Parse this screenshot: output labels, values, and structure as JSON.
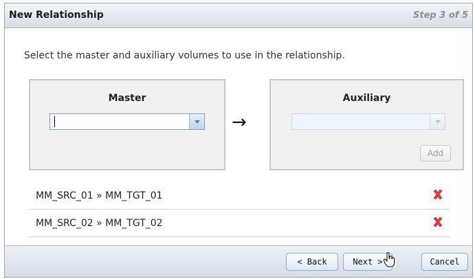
{
  "dialog": {
    "title": "New Relationship",
    "step": "Step 3 of 5"
  },
  "instruction": "Select the master and auxiliary volumes to use in the relationship.",
  "master": {
    "label": "Master",
    "value": ""
  },
  "auxiliary": {
    "label": "Auxiliary",
    "value": "",
    "add_label": "Add"
  },
  "arrow": "→",
  "relationships": [
    {
      "label": "MM_SRC_01 » MM_TGT_01"
    },
    {
      "label": "MM_SRC_02 » MM_TGT_02"
    }
  ],
  "footer": {
    "back_label": "< Back",
    "next_label": "Next >",
    "cancel_label": "Cancel"
  },
  "colors": {
    "delete_icon": "#d9423a",
    "panel_border": "#c9c9c9"
  }
}
